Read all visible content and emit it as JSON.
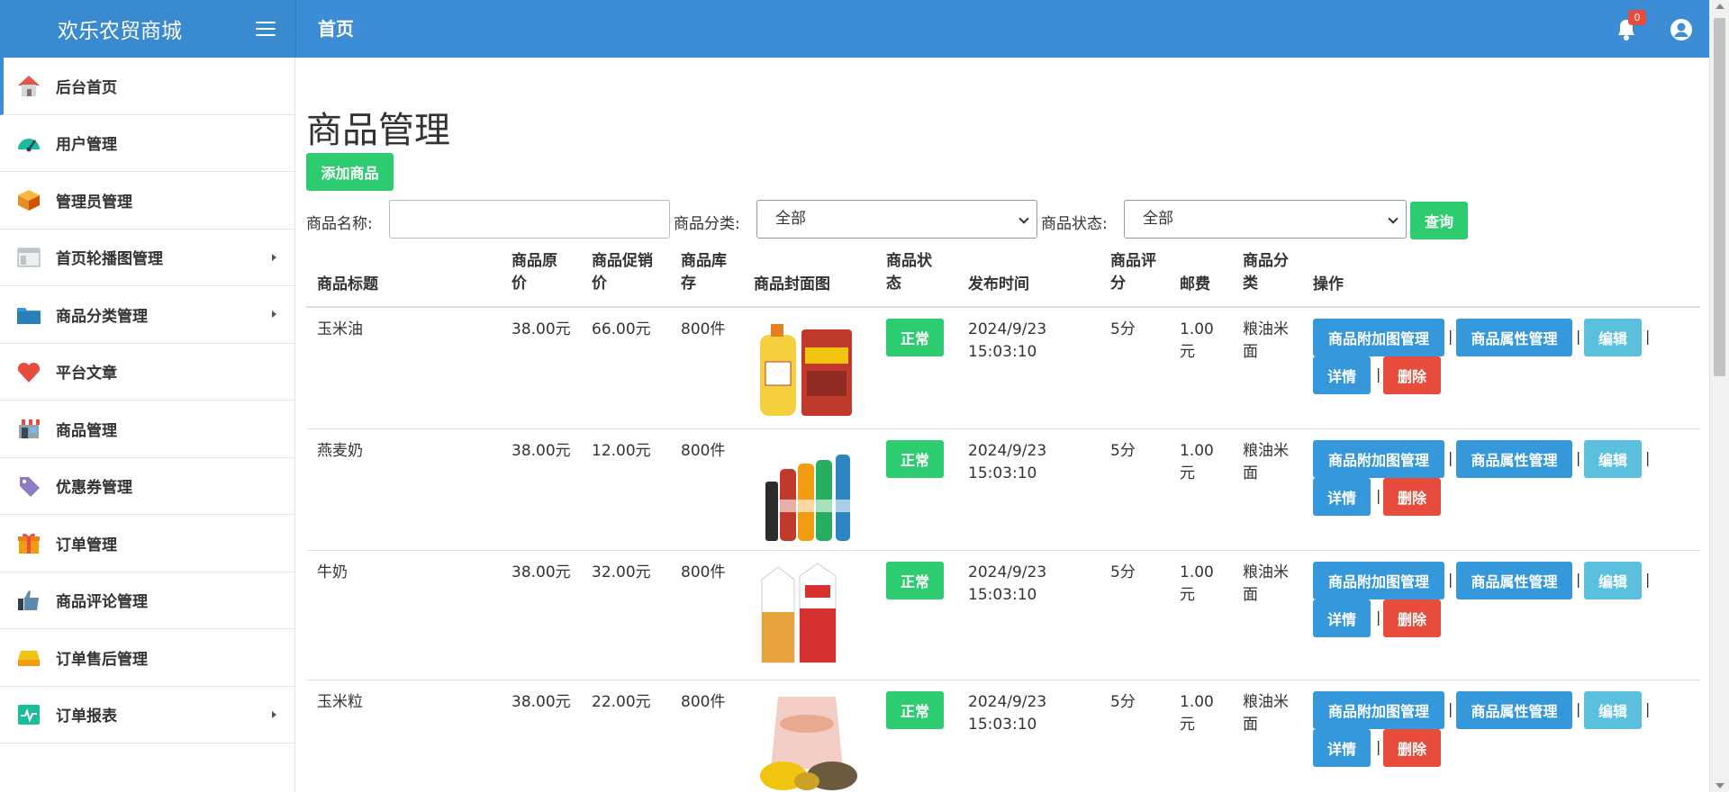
{
  "app": {
    "brand": "欢乐农贸商城",
    "page_crumb": "首页",
    "notification_count": "0"
  },
  "sidebar": {
    "items": [
      {
        "label": "后台首页",
        "icon": "house-icon",
        "arrow": false
      },
      {
        "label": "用户管理",
        "icon": "gauge-icon",
        "arrow": false
      },
      {
        "label": "管理员管理",
        "icon": "box-icon",
        "arrow": false
      },
      {
        "label": "首页轮播图管理",
        "icon": "window-icon",
        "arrow": true
      },
      {
        "label": "商品分类管理",
        "icon": "folder-icon",
        "arrow": true
      },
      {
        "label": "平台文章",
        "icon": "heart-icon",
        "arrow": false
      },
      {
        "label": "商品管理",
        "icon": "shop-icon",
        "arrow": false
      },
      {
        "label": "优惠券管理",
        "icon": "tag-icon",
        "arrow": false
      },
      {
        "label": "订单管理",
        "icon": "gift-icon",
        "arrow": false
      },
      {
        "label": "商品评论管理",
        "icon": "thumbs-up-icon",
        "arrow": false
      },
      {
        "label": "订单售后管理",
        "icon": "tray-icon",
        "arrow": false
      },
      {
        "label": "订单报表",
        "icon": "pulse-icon",
        "arrow": true
      }
    ]
  },
  "main": {
    "title": "商品管理",
    "add_label": "添加商品",
    "filters": {
      "name_label": "商品名称:",
      "name_value": "",
      "category_label": "商品分类:",
      "category_value": "全部",
      "status_label": "商品状态:",
      "status_value": "全部",
      "query_label": "查询"
    },
    "table": {
      "headers": {
        "title": "商品标题",
        "orig_price_1": "商品原",
        "orig_price_2": "价",
        "promo_price_1": "商品促销",
        "promo_price_2": "价",
        "stock_1": "商品库",
        "stock_2": "存",
        "cover": "商品封面图",
        "status_1": "商品状",
        "status_2": "态",
        "publish_time": "发布时间",
        "rating_1": "商品评",
        "rating_2": "分",
        "postage": "邮费",
        "category_1": "商品分",
        "category_2": "类",
        "actions": "操作"
      },
      "actions": {
        "extra_images": "商品附加图管理",
        "attributes": "商品属性管理",
        "edit": "编辑",
        "detail": "详情",
        "delete": "删除",
        "separator": "|"
      },
      "rows": [
        {
          "title": "玉米油",
          "orig_price": "38.00元",
          "promo_price": "66.00元",
          "stock": "800件",
          "status": "正常",
          "date": "2024/9/23",
          "time": "15:03:10",
          "rating": "5分",
          "postage_1": "1.00",
          "postage_2": "元",
          "category_1": "粮油米",
          "category_2": "面"
        },
        {
          "title": "燕麦奶",
          "orig_price": "38.00元",
          "promo_price": "12.00元",
          "stock": "800件",
          "status": "正常",
          "date": "2024/9/23",
          "time": "15:03:10",
          "rating": "5分",
          "postage_1": "1.00",
          "postage_2": "元",
          "category_1": "粮油米",
          "category_2": "面"
        },
        {
          "title": "牛奶",
          "orig_price": "38.00元",
          "promo_price": "32.00元",
          "stock": "800件",
          "status": "正常",
          "date": "2024/9/23",
          "time": "15:03:10",
          "rating": "5分",
          "postage_1": "1.00",
          "postage_2": "元",
          "category_1": "粮油米",
          "category_2": "面"
        },
        {
          "title": "玉米粒",
          "orig_price": "38.00元",
          "promo_price": "22.00元",
          "stock": "800件",
          "status": "正常",
          "date": "2024/9/23",
          "time": "15:03:10",
          "rating": "5分",
          "postage_1": "1.00",
          "postage_2": "元",
          "category_1": "粮油米",
          "category_2": "面"
        }
      ]
    }
  },
  "colors": {
    "header_blue": "#3c8dd6",
    "green": "#2ecc71",
    "blue": "#3498db",
    "cyan": "#5bc0de",
    "red": "#e74c3c"
  }
}
